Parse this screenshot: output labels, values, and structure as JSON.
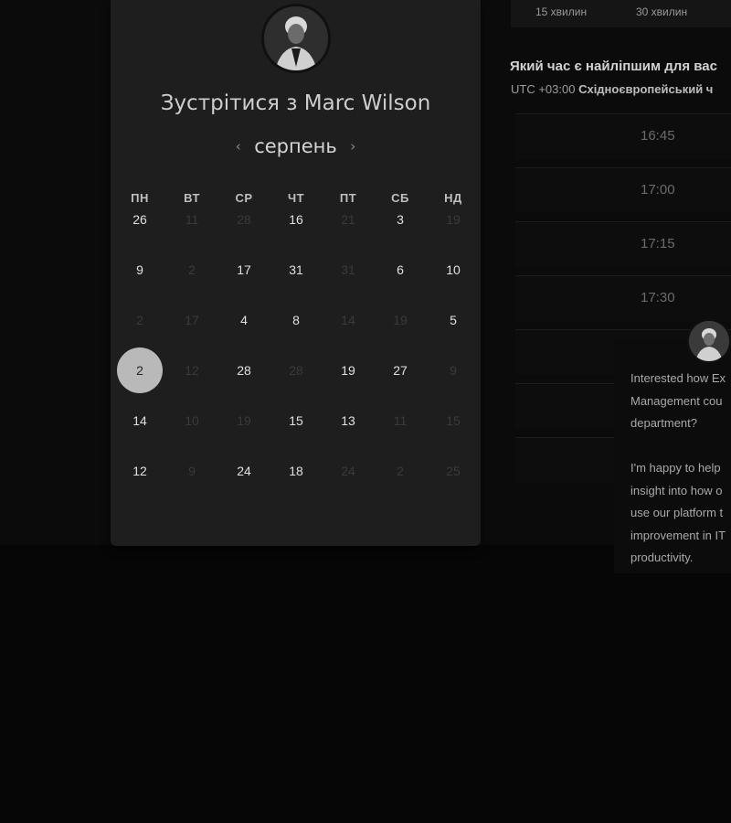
{
  "host": {
    "avatar_icon": "user-avatar-icon",
    "title": "Зустрітися з Marc Wilson"
  },
  "calendar": {
    "month": "серпень",
    "weekdays": [
      "ПН",
      "ВТ",
      "СР",
      "ЧТ",
      "ПТ",
      "СБ",
      "НД"
    ],
    "days": [
      [
        "26",
        "11",
        "28",
        "16",
        "21",
        "3",
        "19"
      ],
      [
        "9",
        "2",
        "17",
        "31",
        "31",
        "6",
        "10"
      ],
      [
        "2",
        "17",
        "4",
        "8",
        "14",
        "19",
        "5"
      ],
      [
        "2",
        "12",
        "28",
        "28",
        "19",
        "27",
        "9"
      ],
      [
        "14",
        "10",
        "19",
        "15",
        "13",
        "11",
        "15"
      ],
      [
        "12",
        "9",
        "24",
        "18",
        "24",
        "2",
        "25"
      ]
    ],
    "available": [
      [
        true,
        false,
        false,
        true,
        false,
        true,
        false
      ],
      [
        true,
        false,
        true,
        true,
        false,
        true,
        true
      ],
      [
        false,
        false,
        true,
        true,
        false,
        false,
        true
      ],
      [
        true,
        false,
        true,
        false,
        true,
        true,
        false
      ],
      [
        true,
        false,
        false,
        true,
        true,
        false,
        false
      ],
      [
        true,
        false,
        true,
        true,
        false,
        false,
        false
      ]
    ],
    "selected": "2"
  },
  "durations": [
    "15 хвилин",
    "30 хвилин"
  ],
  "schedule": {
    "question": "Який час є найліпшим для вас",
    "tz_offset": "UTC +03:00",
    "tz_name": "Східноєвропейський ч",
    "slots": [
      "16:45",
      "17:00",
      "17:15",
      "17:30",
      "",
      "",
      ""
    ]
  },
  "chat": {
    "lines": [
      "Interested how Ex",
      "Management cou",
      "department?",
      "",
      "I'm happy to help",
      "insight into how o",
      "use our platform t",
      "improvement in IT",
      "productivity."
    ]
  },
  "colors": {
    "background": "#060606",
    "card": "#1e1e1e",
    "selected": "#b9b9b9"
  }
}
